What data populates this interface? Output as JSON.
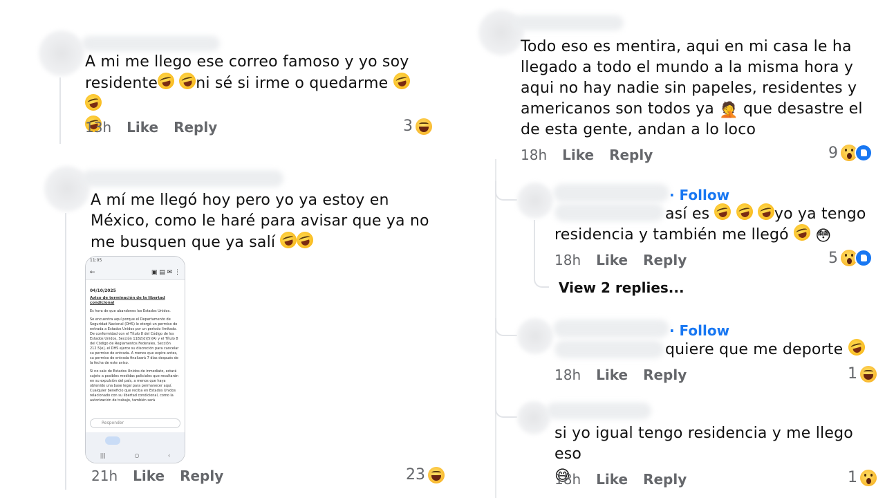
{
  "comments": {
    "c1": {
      "text": "A mi me llego ese correo famoso y yo soy residente",
      "text_after_emoji": "ni sé si irme o quedarme",
      "time": "13h",
      "like": "Like",
      "reply": "Reply",
      "count": "3",
      "reaction": "haha-icon"
    },
    "c2": {
      "text": "A mí me llegó hoy pero yo ya estoy en México, como le haré para avisar que ya no me busquen que ya salí",
      "time": "21h",
      "like": "Like",
      "reply": "Reply",
      "count": "23",
      "reaction": "haha-icon",
      "attachment": {
        "status": "11:05",
        "date": "04/10/2025",
        "subject": "Aviso de terminación de la libertad condicional",
        "p1": "Es hora de que abandones los Estados Unidos.",
        "p2": "Se encuentra aquí porque el Departamento de Seguridad Nacional (DHS) le otorgó un permiso de entrada a Estados Unidos por un período limitado. De conformidad con el Título 8 del Código de los Estados Unidos, Sección 1182(d)(5)(A) y el Título 8 del Código de Reglamentos Federales, Sección 212.5(e), el DHS ejerce su discreción para cancelar su permiso de entrada. A menos que expire antes, su permiso de entrada finalizará 7 días después de la fecha de este aviso.",
        "p3": "Si no sale de Estados Unidos de inmediato, estará sujeto a posibles medidas policiales que resultarán en su expulsión del país, a menos que haya obtenido una base legal para permanecer aquí. Cualquier beneficio que reciba en Estados Unidos relacionado con su libertad condicional, como la autorización de trabajo, también será",
        "reply_placeholder": "Responder"
      }
    },
    "c3": {
      "text": "Todo eso es mentira, aqui en mi casa le ha llegado a todo el mundo a la misma hora y aqui no hay nadie sin papeles, residentes y americanos son todos ya",
      "text_after_emoji": "que desastre el de esta gente, andan a lo loco",
      "time": "18h",
      "like": "Like",
      "reply": "Reply",
      "count": "9"
    },
    "r1": {
      "follow": "· Follow",
      "text_pre": "así es",
      "text_mid": "yo ya tengo",
      "text_line2": "residencia y también me llegó",
      "time": "18h",
      "like": "Like",
      "reply": "Reply",
      "count": "5",
      "view_replies": "View 2 replies..."
    },
    "r2": {
      "follow": "· Follow",
      "text": "quiere que me deporte",
      "time": "18h",
      "like": "Like",
      "reply": "Reply",
      "count": "1"
    },
    "r3": {
      "text": "si yo igual tengo residencia  y me llego eso",
      "time": "18h",
      "like": "Like",
      "reply": "Reply",
      "count": "1"
    }
  }
}
